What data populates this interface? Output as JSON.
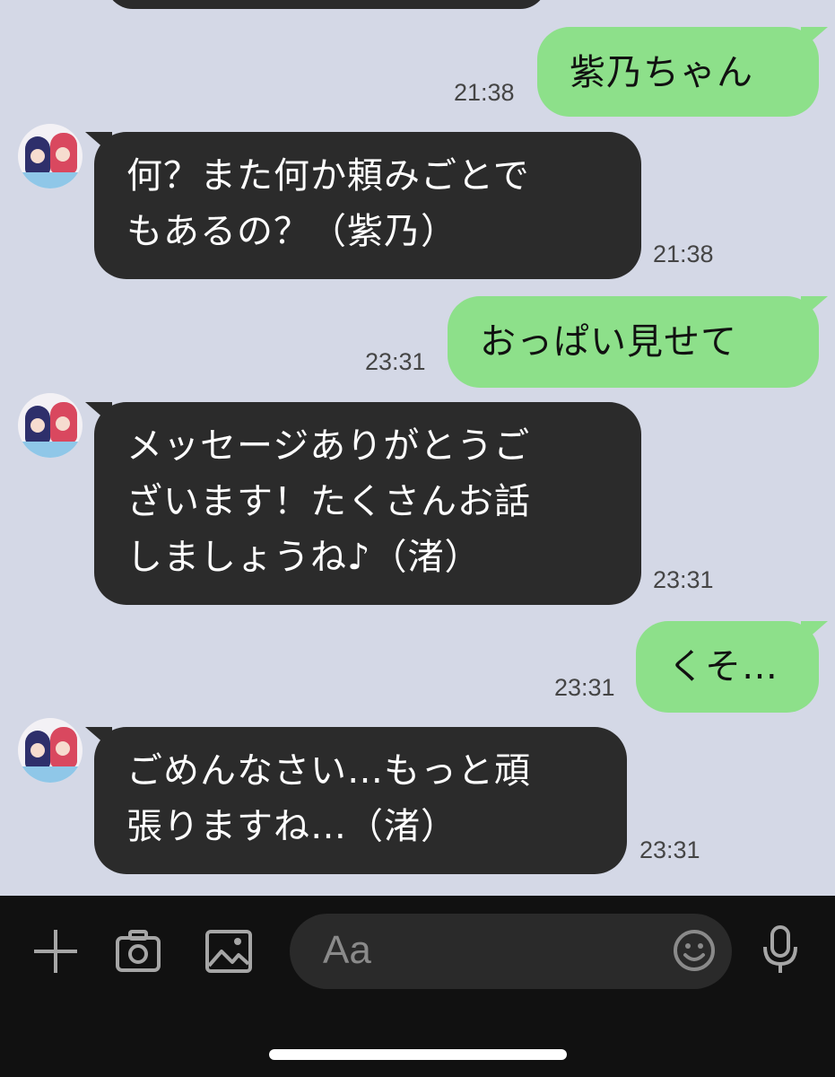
{
  "messages": [
    {
      "side": "out",
      "lines": [
        "紫乃ちゃん"
      ],
      "time": "21:38"
    },
    {
      "side": "in",
      "lines": [
        "何？また何か頼みごとで",
        "もあるの？（紫乃）"
      ],
      "time": "21:38"
    },
    {
      "side": "out",
      "lines": [
        "おっぱい見せて"
      ],
      "time": "23:31"
    },
    {
      "side": "in",
      "lines": [
        "メッセージありがとうご",
        "ざいます！たくさんお話",
        "しましょうね♪（渚）"
      ],
      "time": "23:31"
    },
    {
      "side": "out",
      "lines": [
        "くそ…"
      ],
      "time": "23:31"
    },
    {
      "side": "in",
      "lines": [
        "ごめんなさい…もっと頑",
        "張りますね…（渚）"
      ],
      "time": "23:31"
    }
  ],
  "input_bar": {
    "placeholder": "Aa",
    "icons": [
      "plus-icon",
      "camera-icon",
      "image-icon",
      "emoji-icon",
      "microphone-icon"
    ]
  },
  "colors": {
    "background": "#d4d8e6",
    "incoming_bubble": "#2b2b2b",
    "outgoing_bubble": "#8de08a",
    "input_bar": "#111111"
  }
}
